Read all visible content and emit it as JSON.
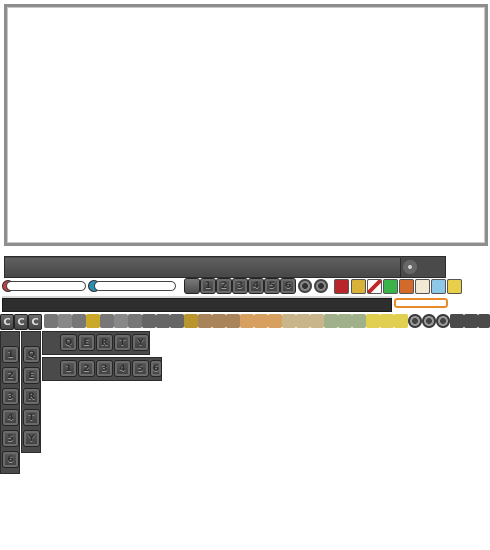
{
  "hotbar": {
    "slot_keys": [
      "1",
      "2",
      "3",
      "4",
      "5",
      "6"
    ]
  },
  "letter_keys": [
    "Q",
    "E",
    "R",
    "T",
    "Y"
  ],
  "number_keys": [
    "1",
    "2",
    "3",
    "4",
    "5",
    "6"
  ],
  "side_column_a": [
    "1",
    "2",
    "3",
    "4",
    "5",
    "6"
  ],
  "side_column_b": [
    "Q",
    "E",
    "R",
    "T",
    "Y"
  ],
  "skill_strip": {
    "c_labels": [
      "C",
      "C",
      "C"
    ]
  },
  "colors": {
    "panel_dark": "#4a4a4a",
    "frame_gray": "#8e8e8e",
    "exp_border_orange": "#e98a2a",
    "hp_orb": "#c04040",
    "mp_orb": "#2a8fb0"
  },
  "icons": [
    "devil-icon",
    "shield-icon",
    "red-potion-icon",
    "green-x-icon",
    "fire-icon",
    "question-bubble-icon",
    "map-icon",
    "duck-icon"
  ]
}
